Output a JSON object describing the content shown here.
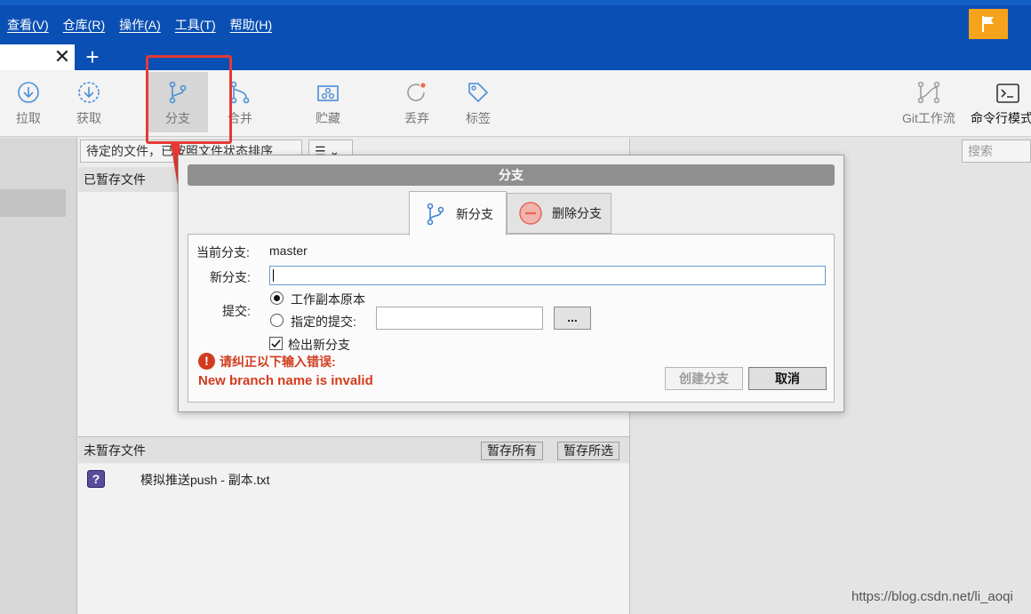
{
  "menu": [
    "查看(V)",
    "仓库(R)",
    "操作(A)",
    "工具(T)",
    "帮助(H)"
  ],
  "tab": {
    "close": "✕",
    "add": "+"
  },
  "toolbar": {
    "pull": "拉取",
    "fetch": "获取",
    "branch": "分支",
    "merge": "合并",
    "stash": "贮藏",
    "discard": "丢弃",
    "tag": "标签",
    "gitflow": "Git工作流",
    "terminal": "命令行模式"
  },
  "files": {
    "filter": "待定的文件，已按照文件状态排序",
    "menu_icon": "☰ ⌄",
    "search_placeholder": "搜索",
    "staged_header": "已暂存文件",
    "unstaged_header": "未暂存文件",
    "stage_all": "暂存所有",
    "stage_selected": "暂存所选",
    "items": [
      {
        "icon": "?",
        "name": "模拟推送push - 副本.txt"
      }
    ]
  },
  "dialog": {
    "title": "分支",
    "tab_new": "新分支",
    "tab_delete": "删除分支",
    "current_label": "当前分支:",
    "current_value": "master",
    "new_label": "新分支:",
    "new_value": "",
    "commit_label": "提交:",
    "radio_working": "工作副本原本",
    "radio_specified": "指定的提交:",
    "browse": "...",
    "checkout_label": "检出新分支",
    "checkout_checked": true,
    "error_title": "请纠正以下输入错误:",
    "error_message": "New branch name is invalid",
    "create_button": "创建分支",
    "cancel_button": "取消"
  },
  "watermark": "https://blog.csdn.net/li_aoqi",
  "colors": {
    "title_bar": "#0a4fb4",
    "flag_button": "#f7a21b",
    "annotation_red": "#e53935",
    "error_text": "#d23c1e"
  }
}
